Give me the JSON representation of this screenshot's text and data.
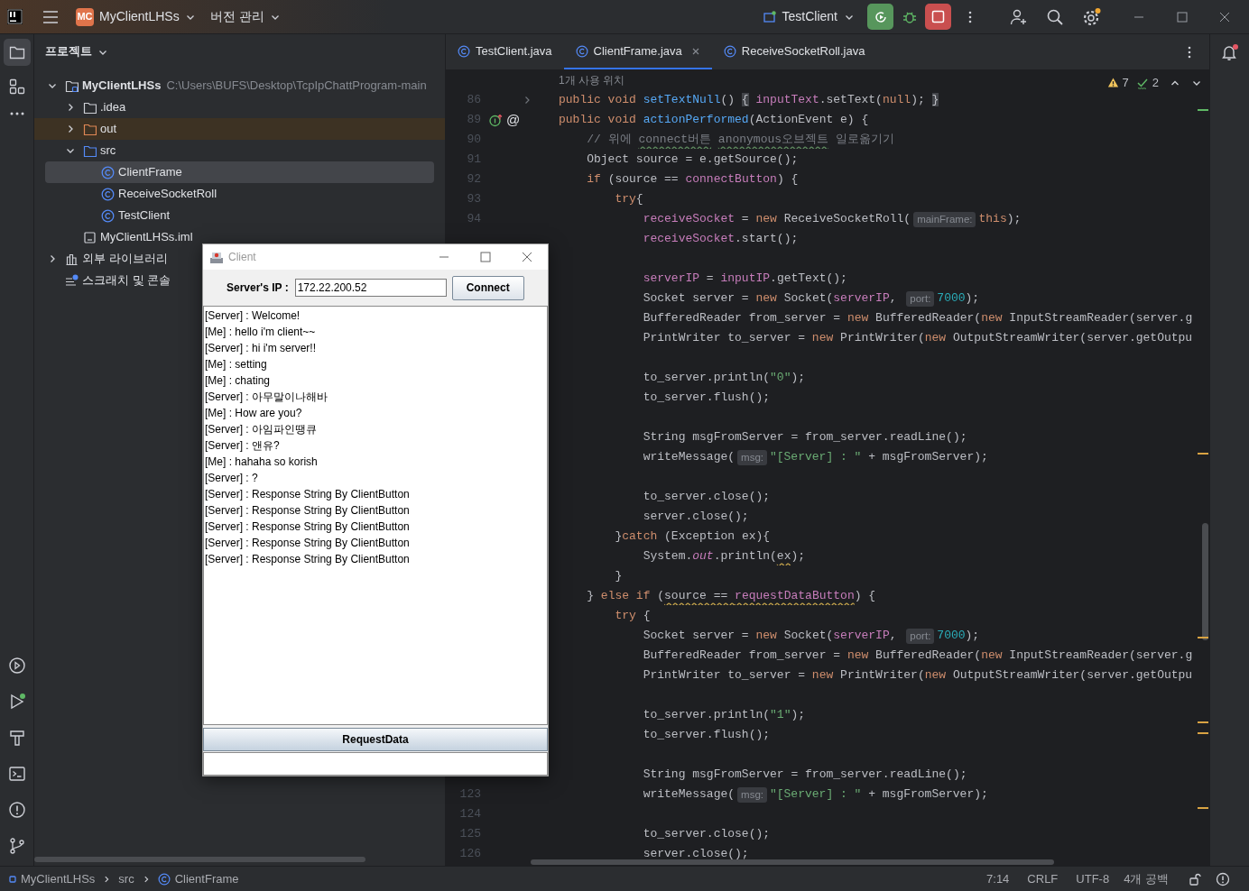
{
  "title_bar": {
    "project_badge": "MC",
    "project": "MyClientLHSs",
    "vcs": "버전 관리",
    "run_config": "TestClient"
  },
  "project_panel": {
    "title": "프로젝트",
    "tree": [
      {
        "label": "MyClientLHSs",
        "path": "C:\\Users\\BUFS\\Desktop\\TcpIpChattProgram-main",
        "kind": "module",
        "expanded": true,
        "selected": false,
        "children": [
          {
            "label": ".idea",
            "kind": "folder",
            "expanded": false,
            "selected": false
          },
          {
            "label": "out",
            "kind": "excluded",
            "expanded": false,
            "selected": false
          },
          {
            "label": "src",
            "kind": "source",
            "expanded": true,
            "selected": false,
            "children": [
              {
                "label": "ClientFrame",
                "kind": "class",
                "selected": true
              },
              {
                "label": "ReceiveSocketRoll",
                "kind": "class",
                "selected": false
              },
              {
                "label": "TestClient",
                "kind": "class",
                "selected": false
              }
            ]
          },
          {
            "label": "MyClientLHSs.iml",
            "kind": "file",
            "selected": false
          }
        ]
      },
      {
        "label": "외부 라이브러리",
        "kind": "library",
        "expanded": false,
        "selected": false
      },
      {
        "label": "스크래치 및 콘솔",
        "kind": "scratch",
        "selected": false
      }
    ]
  },
  "editor": {
    "tabs": [
      {
        "label": "TestClient.java",
        "selected": false
      },
      {
        "label": "ClientFrame.java",
        "selected": true
      },
      {
        "label": "ReceiveSocketRoll.java",
        "selected": false
      }
    ],
    "usages": "1개 사용 위치",
    "warnings": "7",
    "checks": "2",
    "lines": [
      {
        "kind": "code",
        "n": "86",
        "folded": true,
        "segs": [
          {
            "kind": "kw",
            "text": "public void "
          },
          {
            "kind": "fn",
            "text": "setTextNull"
          },
          {
            "kind": "pl",
            "text": "() "
          },
          {
            "kind": "brace",
            "text": "{"
          },
          {
            "kind": "field",
            "text": " inputText"
          },
          {
            "kind": "pl",
            "text": ".setText("
          },
          {
            "kind": "kw",
            "text": "null"
          },
          {
            "kind": "pl",
            "text": "); "
          },
          {
            "kind": "brace",
            "text": "}"
          }
        ]
      },
      {
        "kind": "code",
        "n": "89",
        "overridden": true,
        "gutter_text": "@",
        "segs": [
          {
            "kind": "kw",
            "text": "public void "
          },
          {
            "kind": "fn",
            "text": "actionPerformed"
          },
          {
            "kind": "pl",
            "text": "(ActionEvent e) {"
          }
        ]
      },
      {
        "kind": "code",
        "n": "90",
        "segs": [
          {
            "kind": "cm",
            "text": "    // 위에 "
          },
          {
            "kind": "cm",
            "text": "connect버튼",
            "typo": true
          },
          {
            "kind": "cm",
            "text": " anonymous오브젝트",
            "typo": true
          },
          {
            "kind": "cm",
            "text": " 일로옮기기"
          }
        ]
      },
      {
        "kind": "code",
        "n": "91",
        "segs": [
          {
            "kind": "pl",
            "text": "    Object source = e.getSource();"
          }
        ]
      },
      {
        "kind": "code",
        "n": "92",
        "segs": [
          {
            "kind": "kw",
            "text": "    if"
          },
          {
            "kind": "pl",
            "text": " (source == "
          },
          {
            "kind": "field",
            "text": "connectButton"
          },
          {
            "kind": "pl",
            "text": ") {"
          }
        ]
      },
      {
        "kind": "code",
        "n": "93",
        "segs": [
          {
            "kind": "kw",
            "text": "        try"
          },
          {
            "kind": "pl",
            "text": "{"
          }
        ]
      },
      {
        "kind": "code",
        "n": "94",
        "segs": [
          {
            "kind": "field",
            "text": "            receiveSocket"
          },
          {
            "kind": "pl",
            "text": " = "
          },
          {
            "kind": "kw",
            "text": "new "
          },
          {
            "kind": "pl",
            "text": "ReceiveSocketRoll("
          },
          {
            "kind": "hint",
            "text": "mainFrame:"
          },
          {
            "kind": "kw",
            "text": "this"
          },
          {
            "kind": "pl",
            "text": ");"
          }
        ]
      },
      {
        "kind": "code",
        "segs": [
          {
            "kind": "field",
            "text": "            receiveSocket"
          },
          {
            "kind": "pl",
            "text": ".start();"
          }
        ]
      },
      {
        "kind": "blank"
      },
      {
        "kind": "code",
        "segs": [
          {
            "kind": "field",
            "text": "            serverIP"
          },
          {
            "kind": "pl",
            "text": " = "
          },
          {
            "kind": "field",
            "text": "inputIP"
          },
          {
            "kind": "pl",
            "text": ".getText();"
          }
        ]
      },
      {
        "kind": "code",
        "segs": [
          {
            "kind": "pl",
            "text": "            Socket server = "
          },
          {
            "kind": "kw",
            "text": "new "
          },
          {
            "kind": "pl",
            "text": "Socket("
          },
          {
            "kind": "field",
            "text": "serverIP"
          },
          {
            "kind": "pl",
            "text": ", "
          },
          {
            "kind": "hint",
            "text": "port:"
          },
          {
            "kind": "num",
            "text": "7000"
          },
          {
            "kind": "pl",
            "text": ");"
          }
        ]
      },
      {
        "kind": "code",
        "segs": [
          {
            "kind": "pl",
            "text": "            BufferedReader from_server = "
          },
          {
            "kind": "kw",
            "text": "new "
          },
          {
            "kind": "pl",
            "text": "BufferedReader("
          },
          {
            "kind": "kw",
            "text": "new "
          },
          {
            "kind": "pl",
            "text": "InputStreamReader(server.g"
          }
        ]
      },
      {
        "kind": "code",
        "segs": [
          {
            "kind": "pl",
            "text": "            PrintWriter to_server = "
          },
          {
            "kind": "kw",
            "text": "new "
          },
          {
            "kind": "pl",
            "text": "PrintWriter("
          },
          {
            "kind": "kw",
            "text": "new "
          },
          {
            "kind": "pl",
            "text": "OutputStreamWriter(server.getOutpu"
          }
        ]
      },
      {
        "kind": "blank"
      },
      {
        "kind": "code",
        "segs": [
          {
            "kind": "pl",
            "text": "            to_server.println("
          },
          {
            "kind": "str",
            "text": "\"0\""
          },
          {
            "kind": "pl",
            "text": ");"
          }
        ]
      },
      {
        "kind": "code",
        "segs": [
          {
            "kind": "pl",
            "text": "            to_server.flush();"
          }
        ]
      },
      {
        "kind": "blank"
      },
      {
        "kind": "code",
        "segs": [
          {
            "kind": "pl",
            "text": "            String msgFromServer = from_server.readLine();"
          }
        ]
      },
      {
        "kind": "code",
        "segs": [
          {
            "kind": "pl",
            "text": "            writeMessage("
          },
          {
            "kind": "hint",
            "text": "msg:"
          },
          {
            "kind": "str",
            "text": "\"[Server] : \""
          },
          {
            "kind": "pl",
            "text": " + msgFromServer);"
          }
        ]
      },
      {
        "kind": "blank"
      },
      {
        "kind": "code",
        "segs": [
          {
            "kind": "pl",
            "text": "            to_server.close();"
          }
        ]
      },
      {
        "kind": "code",
        "segs": [
          {
            "kind": "pl",
            "text": "            server.close();"
          }
        ]
      },
      {
        "kind": "code",
        "segs": [
          {
            "kind": "pl",
            "text": "        }"
          },
          {
            "kind": "kw",
            "text": "catch"
          },
          {
            "kind": "pl",
            "text": " (Exception ex){"
          }
        ]
      },
      {
        "kind": "code",
        "segs": [
          {
            "kind": "pl",
            "text": "            System."
          },
          {
            "kind": "stat",
            "text": "out"
          },
          {
            "kind": "pl",
            "text": ".println("
          },
          {
            "kind": "pl",
            "text": "ex",
            "warning": true
          },
          {
            "kind": "pl",
            "text": ");"
          }
        ]
      },
      {
        "kind": "code",
        "segs": [
          {
            "kind": "pl",
            "text": "        }"
          }
        ]
      },
      {
        "kind": "code",
        "segs": [
          {
            "kind": "pl",
            "text": "    } "
          },
          {
            "kind": "kw",
            "text": "else if"
          },
          {
            "kind": "pl",
            "text": " ("
          },
          {
            "kind": "pl",
            "text": "source == ",
            "warning": true
          },
          {
            "kind": "field",
            "text": "requestDataButton",
            "warning": true
          },
          {
            "kind": "pl",
            "text": ") {"
          }
        ]
      },
      {
        "kind": "code",
        "segs": [
          {
            "kind": "kw",
            "text": "        try"
          },
          {
            "kind": "pl",
            "text": " {"
          }
        ]
      },
      {
        "kind": "code",
        "segs": [
          {
            "kind": "pl",
            "text": "            Socket server = "
          },
          {
            "kind": "kw",
            "text": "new "
          },
          {
            "kind": "pl",
            "text": "Socket("
          },
          {
            "kind": "field",
            "text": "serverIP"
          },
          {
            "kind": "pl",
            "text": ", "
          },
          {
            "kind": "hint",
            "text": "port:"
          },
          {
            "kind": "num",
            "text": "7000"
          },
          {
            "kind": "pl",
            "text": ");"
          }
        ]
      },
      {
        "kind": "code",
        "segs": [
          {
            "kind": "pl",
            "text": "            BufferedReader from_server = "
          },
          {
            "kind": "kw",
            "text": "new "
          },
          {
            "kind": "pl",
            "text": "BufferedReader("
          },
          {
            "kind": "kw",
            "text": "new "
          },
          {
            "kind": "pl",
            "text": "InputStreamReader(server.g"
          }
        ]
      },
      {
        "kind": "code",
        "segs": [
          {
            "kind": "pl",
            "text": "            PrintWriter to_server = "
          },
          {
            "kind": "kw",
            "text": "new "
          },
          {
            "kind": "pl",
            "text": "PrintWriter("
          },
          {
            "kind": "kw",
            "text": "new "
          },
          {
            "kind": "pl",
            "text": "OutputStreamWriter(server.getOutpu"
          }
        ]
      },
      {
        "kind": "blank"
      },
      {
        "kind": "code",
        "segs": [
          {
            "kind": "pl",
            "text": "            to_server.println("
          },
          {
            "kind": "str",
            "text": "\"1\""
          },
          {
            "kind": "pl",
            "text": ");"
          }
        ]
      },
      {
        "kind": "code",
        "segs": [
          {
            "kind": "pl",
            "text": "            to_server.flush();"
          }
        ]
      },
      {
        "kind": "blank"
      },
      {
        "kind": "code",
        "segs": [
          {
            "kind": "pl",
            "text": "            String msgFromServer = from_server.readLine();"
          }
        ]
      },
      {
        "kind": "code",
        "n": "123",
        "segs": [
          {
            "kind": "pl",
            "text": "            writeMessage("
          },
          {
            "kind": "hint",
            "text": "msg:"
          },
          {
            "kind": "str",
            "text": "\"[Server] : \""
          },
          {
            "kind": "pl",
            "text": " + msgFromServer);"
          }
        ]
      },
      {
        "kind": "blank",
        "n": "124"
      },
      {
        "kind": "code",
        "n": "125",
        "segs": [
          {
            "kind": "pl",
            "text": "            to_server.close();"
          }
        ]
      },
      {
        "kind": "code",
        "n": "126",
        "segs": [
          {
            "kind": "pl",
            "text": "            server.close();"
          }
        ]
      }
    ]
  },
  "client_window": {
    "title": "Client",
    "ip_label": "Server's IP :",
    "ip_value": "172.22.200.52",
    "connect_button": "Connect",
    "messages": [
      "[Server] : Welcome!",
      "[Me] : hello i'm client~~",
      "[Server] : hi i'm server!!",
      "[Me] : setting",
      "[Me] : chating",
      "[Server] : 아무말이나해바",
      "[Me] : How are you?",
      "[Server] : 아임파인땡큐",
      "[Server] : 앤유?",
      "[Me] : hahaha so korish",
      "[Server] : ?",
      "[Server] : Response String By ClientButton",
      "[Server] : Response String By ClientButton",
      "[Server] : Response String By ClientButton",
      "[Server] : Response String By ClientButton",
      "[Server] : Response String By ClientButton"
    ],
    "request_button": "RequestData"
  },
  "status_bar": {
    "breadcrumbs": [
      {
        "label": "MyClientLHSs",
        "kind": "module"
      },
      {
        "label": "src",
        "kind": "folder"
      },
      {
        "label": "ClientFrame",
        "kind": "class"
      }
    ],
    "position": "7:14",
    "line_ending": "CRLF",
    "encoding": "UTF-8",
    "indent": "4개 공백"
  }
}
